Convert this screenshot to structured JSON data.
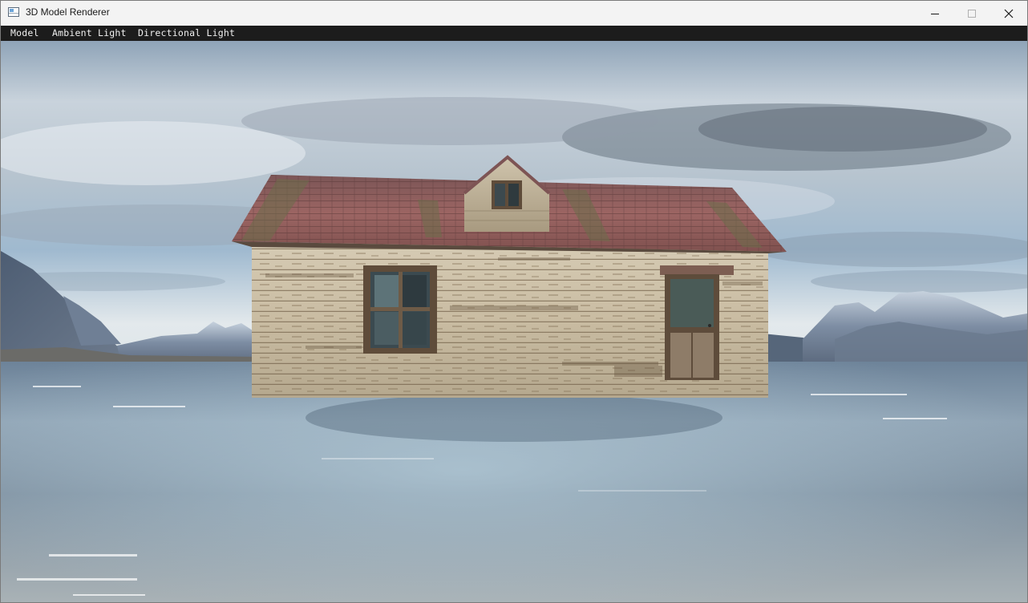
{
  "window": {
    "title": "3D Model Renderer",
    "controls": [
      "minimize",
      "maximize",
      "close"
    ]
  },
  "menu": {
    "items": [
      {
        "label": "Model"
      },
      {
        "label": "Ambient Light"
      },
      {
        "label": "Directional Light"
      }
    ]
  },
  "scene": {
    "model": "abandoned-wooden-house",
    "skybox": "cloudy-sky-over-lake-with-mountains"
  },
  "colors": {
    "menubar_bg": "#1c1c1c",
    "menubar_text": "#f0f0f0",
    "titlebar_bg": "#f3f3f3"
  }
}
